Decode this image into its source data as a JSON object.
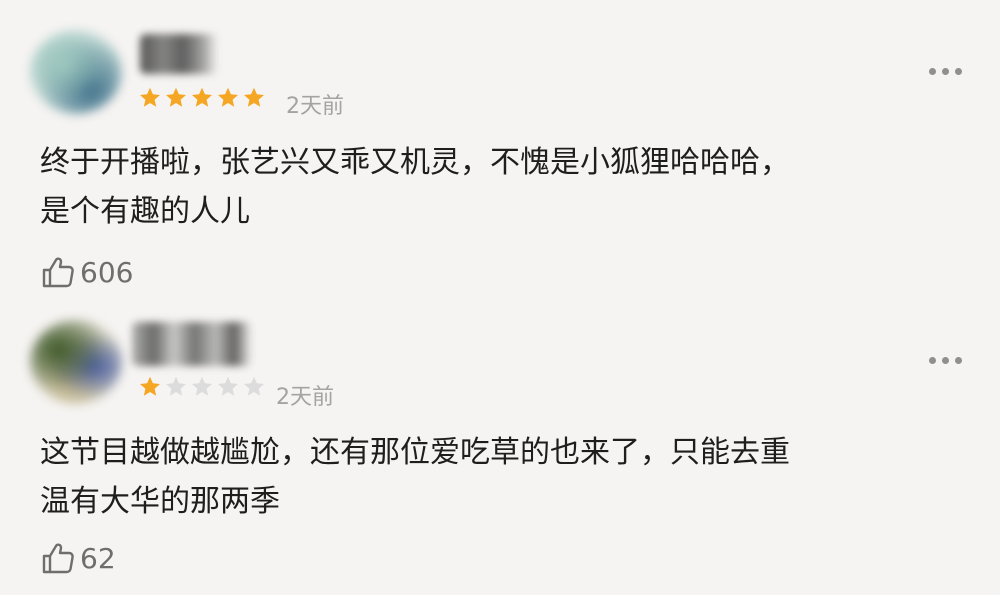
{
  "comments": [
    {
      "rating": 5,
      "rating_max": 5,
      "time": "2天前",
      "text": "终于开播啦，张艺兴又乖又机灵，不愧是小狐狸哈哈哈，\n是个有趣的人儿",
      "likes": "606"
    },
    {
      "rating": 1,
      "rating_max": 5,
      "time": "2天前",
      "text": "这节目越做越尴尬，还有那位爱吃草的也来了，只能去重\n温有大华的那两季",
      "likes": "62"
    }
  ],
  "colors": {
    "star_filled": "#f5a623",
    "star_empty": "#dcdcdc",
    "time_text": "#a3a3a3",
    "like_text": "#6e6e6e",
    "background": "#f6f4f2"
  },
  "icons": {
    "more": "more-dots-icon",
    "like": "thumbs-up-icon",
    "star": "star-icon"
  }
}
